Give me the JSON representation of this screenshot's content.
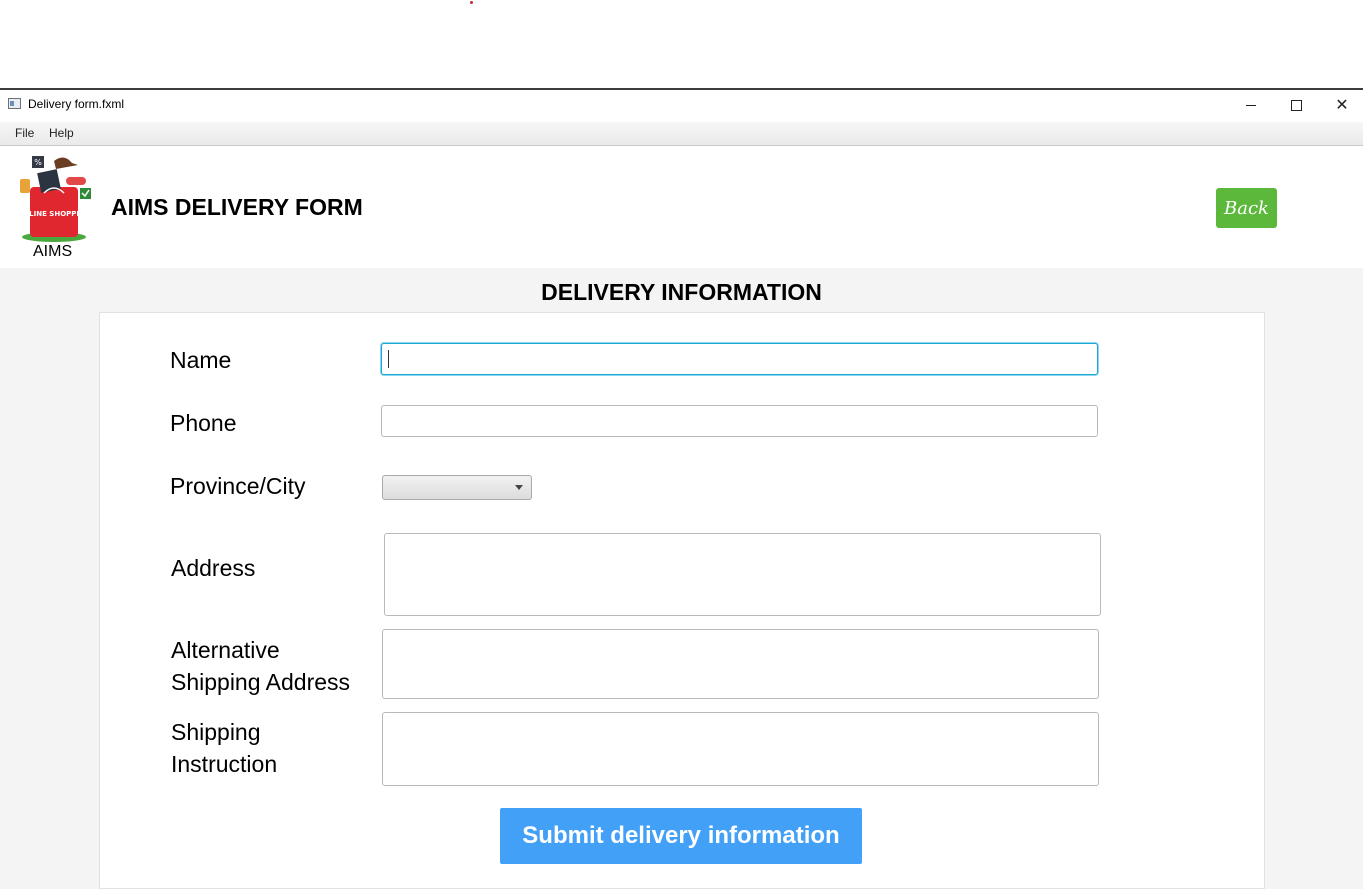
{
  "window": {
    "title": "Delivery form.fxml",
    "minimize_icon": "minimize-icon",
    "maximize_icon": "maximize-icon",
    "close_icon": "close-icon"
  },
  "menu": {
    "file": "File",
    "help": "Help"
  },
  "header": {
    "logo_text": "AIMS",
    "logo_badge_text": "ONLINE SHOPPING",
    "title": "AIMS DELIVERY FORM",
    "back_label": "Back",
    "back_color": "#5cb83a"
  },
  "form": {
    "section_title": "DELIVERY INFORMATION",
    "name_label": "Name",
    "name_value": "",
    "phone_label": "Phone",
    "phone_value": "",
    "province_label": "Province/City",
    "province_value": "",
    "address_label": "Address",
    "address_value": "",
    "alt_address_label": "Alternative\nShipping Address",
    "alt_address_value": "",
    "instruction_label": "Shipping\nInstruction",
    "instruction_value": "",
    "submit_label": "Submit delivery information",
    "submit_color": "#43a0f7",
    "focus_color": "#1ea6d4"
  }
}
